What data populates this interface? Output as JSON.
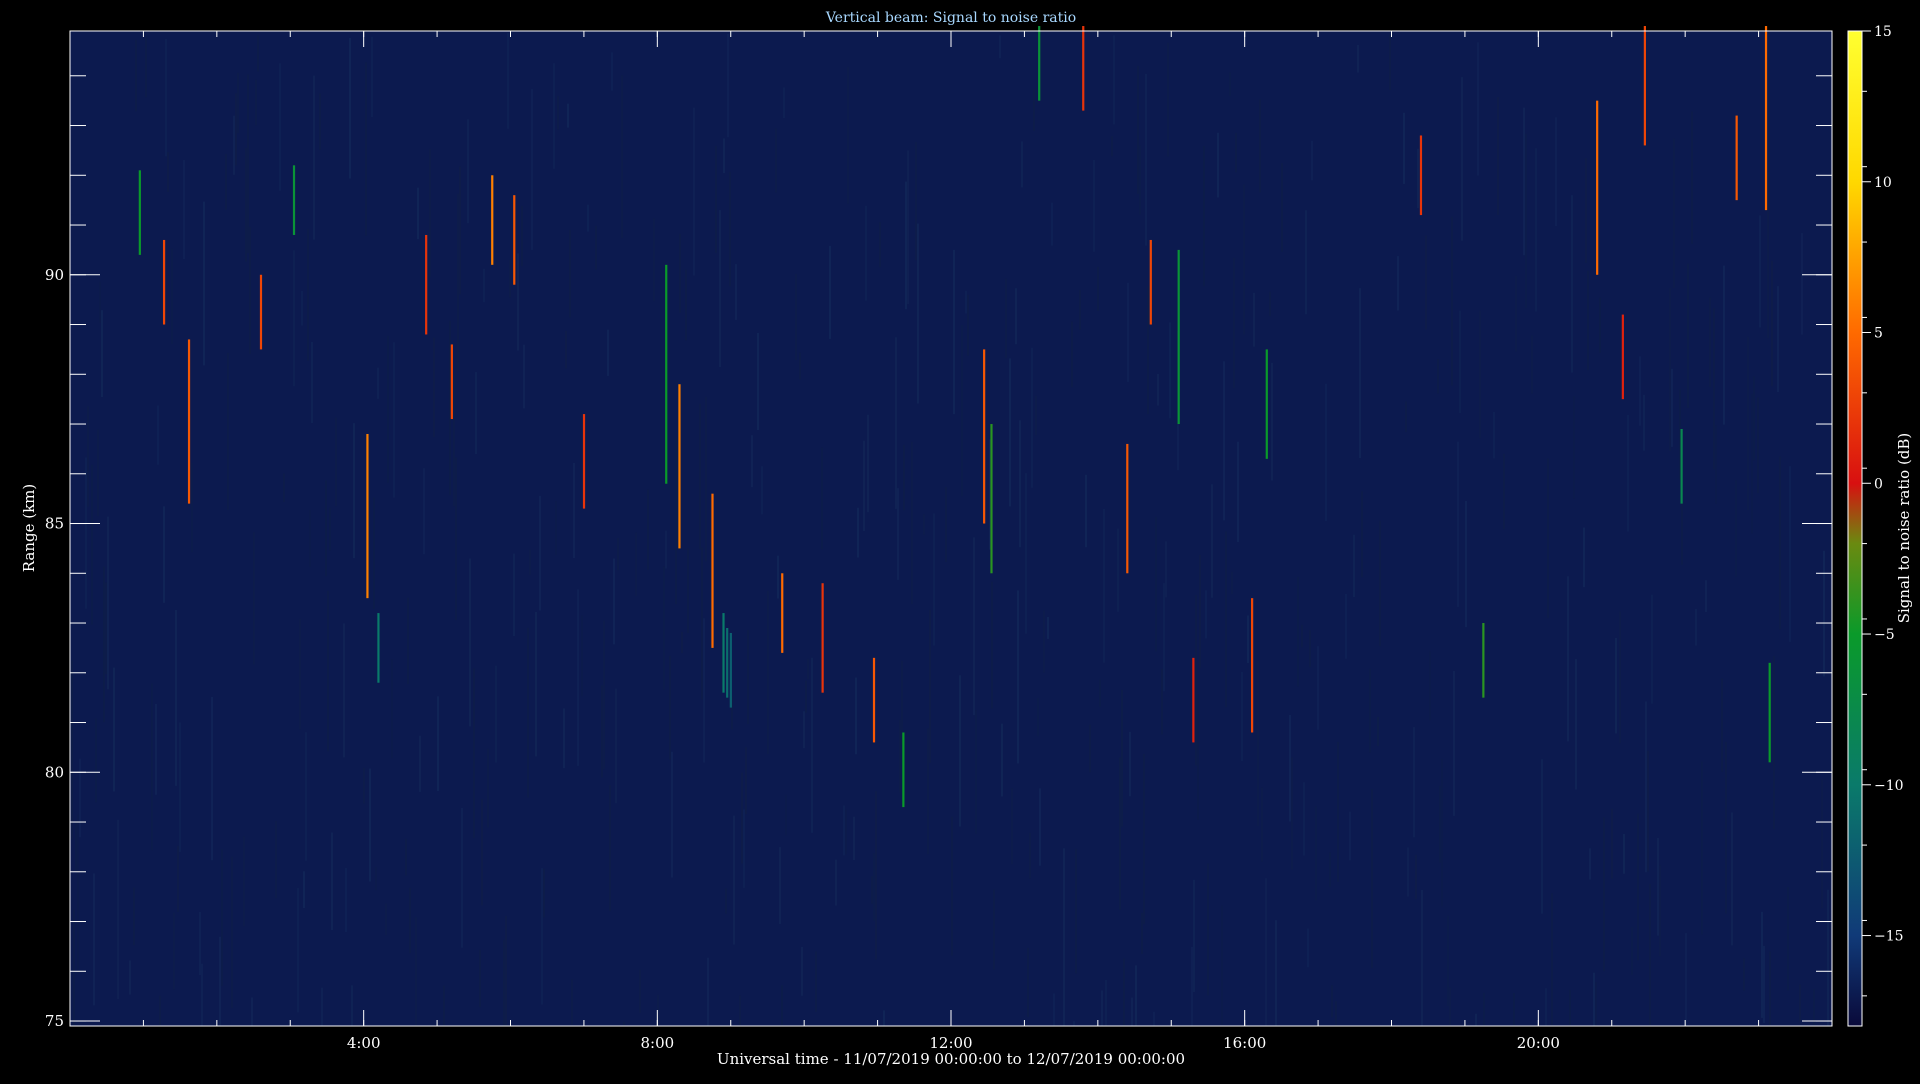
{
  "chart_data": {
    "type": "heatmap",
    "title": "Vertical beam: Signal to noise ratio",
    "xlabel": "Universal time - 11/07/2019 00:00:00 to 12/07/2019 00:00:00",
    "ylabel": "Range (km)",
    "xlim_hours": [
      0,
      24
    ],
    "ylim_km": [
      74.9,
      94.9
    ],
    "x_ticks": [
      {
        "value": 4,
        "label": "4:00"
      },
      {
        "value": 8,
        "label": "8:00"
      },
      {
        "value": 12,
        "label": "12:00"
      },
      {
        "value": 16,
        "label": "16:00"
      },
      {
        "value": 20,
        "label": "20:00"
      }
    ],
    "x_minor_step_hours": 1,
    "y_ticks": [
      {
        "value": 75,
        "label": "75"
      },
      {
        "value": 80,
        "label": "80"
      },
      {
        "value": 85,
        "label": "85"
      },
      {
        "value": 90,
        "label": "90"
      }
    ],
    "y_minor_step_km": 1,
    "background_level_db": -17,
    "colorbar": {
      "label": "Signal to noise ratio (dB)",
      "range": [
        -18,
        15
      ],
      "ticks": [
        {
          "value": -15,
          "label": "−15"
        },
        {
          "value": -10,
          "label": "−10"
        },
        {
          "value": -5,
          "label": "−5"
        },
        {
          "value": 0,
          "label": "0"
        },
        {
          "value": 5,
          "label": "5"
        },
        {
          "value": 10,
          "label": "10"
        },
        {
          "value": 15,
          "label": "15"
        }
      ],
      "colors": [
        "#0a0a3a",
        "#103a78",
        "#0a7a6a",
        "#0a9a2a",
        "#6a8a10",
        "#d81010",
        "#ff6a00",
        "#ffd800",
        "#ffff30"
      ],
      "color_stops": [
        -18,
        -15,
        -10,
        -5,
        -2,
        0,
        5,
        10,
        15
      ]
    },
    "echoes": [
      {
        "t": 0.95,
        "r0": 90.4,
        "r1": 92.1,
        "db": -5
      },
      {
        "t": 1.28,
        "r0": 89.0,
        "r1": 90.7,
        "db": 3
      },
      {
        "t": 1.62,
        "r0": 85.4,
        "r1": 88.7,
        "db": 4
      },
      {
        "t": 2.6,
        "r0": 88.5,
        "r1": 90.0,
        "db": 3
      },
      {
        "t": 3.05,
        "r0": 90.8,
        "r1": 92.2,
        "db": -6
      },
      {
        "t": 4.05,
        "r0": 83.5,
        "r1": 86.8,
        "db": 6
      },
      {
        "t": 4.2,
        "r0": 81.8,
        "r1": 83.2,
        "db": -10
      },
      {
        "t": 4.85,
        "r0": 88.8,
        "r1": 90.8,
        "db": 2
      },
      {
        "t": 5.2,
        "r0": 87.1,
        "r1": 88.6,
        "db": 3
      },
      {
        "t": 5.75,
        "r0": 90.2,
        "r1": 92.0,
        "db": 6
      },
      {
        "t": 6.05,
        "r0": 89.8,
        "r1": 91.6,
        "db": 4
      },
      {
        "t": 7.0,
        "r0": 85.3,
        "r1": 87.2,
        "db": 2
      },
      {
        "t": 8.12,
        "r0": 85.8,
        "r1": 90.2,
        "db": -5
      },
      {
        "t": 8.3,
        "r0": 84.5,
        "r1": 87.8,
        "db": 6
      },
      {
        "t": 8.75,
        "r0": 82.5,
        "r1": 85.6,
        "db": 5
      },
      {
        "t": 8.9,
        "r0": 81.6,
        "r1": 83.2,
        "db": -10
      },
      {
        "t": 8.95,
        "r0": 81.5,
        "r1": 82.9,
        "db": -11
      },
      {
        "t": 9.0,
        "r0": 81.3,
        "r1": 82.8,
        "db": -12
      },
      {
        "t": 9.7,
        "r0": 82.4,
        "r1": 84.0,
        "db": 5
      },
      {
        "t": 10.25,
        "r0": 81.6,
        "r1": 83.8,
        "db": 2
      },
      {
        "t": 10.95,
        "r0": 80.6,
        "r1": 82.3,
        "db": 4
      },
      {
        "t": 11.35,
        "r0": 79.3,
        "r1": 80.8,
        "db": -5
      },
      {
        "t": 12.45,
        "r0": 85.0,
        "r1": 88.5,
        "db": 4
      },
      {
        "t": 12.55,
        "r0": 84.0,
        "r1": 87.0,
        "db": -4
      },
      {
        "t": 13.2,
        "r0": 93.5,
        "r1": 95.0,
        "db": -6
      },
      {
        "t": 13.8,
        "r0": 93.3,
        "r1": 95.0,
        "db": 2
      },
      {
        "t": 14.4,
        "r0": 84.0,
        "r1": 86.6,
        "db": 4
      },
      {
        "t": 14.72,
        "r0": 89.0,
        "r1": 90.7,
        "db": 3
      },
      {
        "t": 15.1,
        "r0": 87.0,
        "r1": 90.5,
        "db": -6
      },
      {
        "t": 15.3,
        "r0": 80.6,
        "r1": 82.3,
        "db": 1
      },
      {
        "t": 16.1,
        "r0": 80.8,
        "r1": 83.5,
        "db": 3
      },
      {
        "t": 16.3,
        "r0": 86.3,
        "r1": 88.5,
        "db": -5
      },
      {
        "t": 18.4,
        "r0": 91.2,
        "r1": 92.8,
        "db": 2
      },
      {
        "t": 19.25,
        "r0": 81.5,
        "r1": 83.0,
        "db": -4
      },
      {
        "t": 20.8,
        "r0": 90.0,
        "r1": 93.5,
        "db": 5
      },
      {
        "t": 21.15,
        "r0": 87.5,
        "r1": 89.2,
        "db": 1
      },
      {
        "t": 21.45,
        "r0": 92.6,
        "r1": 95.0,
        "db": 3
      },
      {
        "t": 21.95,
        "r0": 85.4,
        "r1": 86.9,
        "db": -8
      },
      {
        "t": 22.7,
        "r0": 91.5,
        "r1": 93.2,
        "db": 4
      },
      {
        "t": 23.1,
        "r0": 91.3,
        "r1": 95.0,
        "db": 5
      },
      {
        "t": 23.15,
        "r0": 80.2,
        "r1": 82.2,
        "db": -5
      }
    ]
  }
}
